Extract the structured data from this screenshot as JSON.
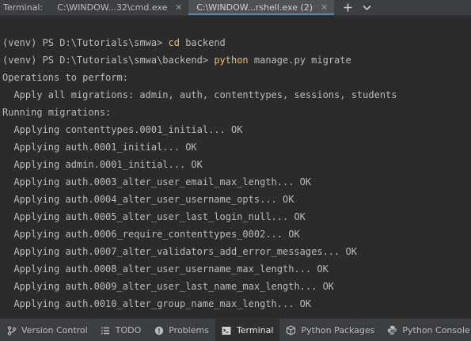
{
  "tabbar": {
    "label": "Terminal:",
    "tabs": [
      {
        "title": "C:\\WINDOW...32\\cmd.exe",
        "active": false
      },
      {
        "title": "C:\\WINDOW...rshell.exe (2)",
        "active": true
      }
    ],
    "close_glyph": "✕",
    "icons": {
      "new_tab": "plus-icon",
      "more": "chevron-down-icon"
    }
  },
  "terminal": {
    "lines": [
      {
        "prefix": "",
        "cmd": "",
        "rest": ""
      },
      {
        "prefix": "(venv) PS D:\\Tutorials\\smwa> ",
        "cmd": "cd",
        "rest": " backend"
      },
      {
        "prefix": "(venv) PS D:\\Tutorials\\smwa\\backend> ",
        "cmd": "python",
        "rest": " manage.py migrate"
      },
      {
        "prefix": "Operations to perform:",
        "cmd": "",
        "rest": ""
      },
      {
        "prefix": "  Apply all migrations: admin, auth, contenttypes, sessions, students",
        "cmd": "",
        "rest": ""
      },
      {
        "prefix": "Running migrations:",
        "cmd": "",
        "rest": ""
      },
      {
        "prefix": "  Applying contenttypes.0001_initial... OK",
        "cmd": "",
        "rest": ""
      },
      {
        "prefix": "  Applying auth.0001_initial... OK",
        "cmd": "",
        "rest": ""
      },
      {
        "prefix": "  Applying admin.0001_initial... OK",
        "cmd": "",
        "rest": ""
      },
      {
        "prefix": "  Applying auth.0003_alter_user_email_max_length... OK",
        "cmd": "",
        "rest": ""
      },
      {
        "prefix": "  Applying auth.0004_alter_user_username_opts... OK",
        "cmd": "",
        "rest": ""
      },
      {
        "prefix": "  Applying auth.0005_alter_user_last_login_null... OK",
        "cmd": "",
        "rest": ""
      },
      {
        "prefix": "  Applying auth.0006_require_contenttypes_0002... OK",
        "cmd": "",
        "rest": ""
      },
      {
        "prefix": "  Applying auth.0007_alter_validators_add_error_messages... OK",
        "cmd": "",
        "rest": ""
      },
      {
        "prefix": "  Applying auth.0008_alter_user_username_max_length... OK",
        "cmd": "",
        "rest": ""
      },
      {
        "prefix": "  Applying auth.0009_alter_user_last_name_max_length... OK",
        "cmd": "",
        "rest": ""
      },
      {
        "prefix": "  Applying auth.0010_alter_group_name_max_length... OK",
        "cmd": "",
        "rest": ""
      }
    ],
    "colors": {
      "text": "#bbbbbb",
      "command": "#e8bf6a",
      "background": "#2b2b2b"
    }
  },
  "toolbar": {
    "items": [
      {
        "label": "Version Control",
        "icon": "branch-icon",
        "active": false
      },
      {
        "label": "TODO",
        "icon": "list-icon",
        "active": false
      },
      {
        "label": "Problems",
        "icon": "problems-icon",
        "active": false
      },
      {
        "label": "Terminal",
        "icon": "terminal-icon",
        "active": true
      },
      {
        "label": "Python Packages",
        "icon": "package-icon",
        "active": false
      },
      {
        "label": "Python Console",
        "icon": "python-console-icon",
        "active": false
      }
    ]
  }
}
